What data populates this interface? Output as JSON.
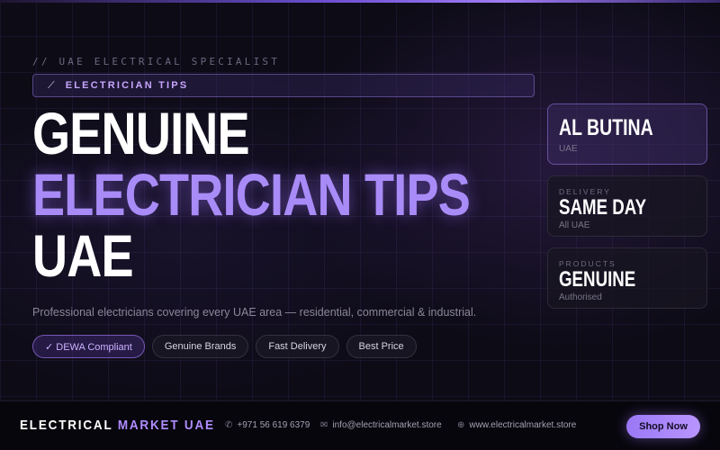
{
  "hero": {
    "eyebrow": "// UAE ELECTRICAL SPECIALIST",
    "tag_icon": "wrench-icon",
    "tag_label": "ELECTRICIAN TIPS",
    "headline_line1": "GENUINE",
    "headline_line2": "ELECTRICIAN TIPS",
    "headline_line3": "UAE",
    "subtitle": "Professional electricians covering every UAE area — residential, commercial & industrial.",
    "pills": [
      {
        "label": "✓ DEWA Compliant"
      },
      {
        "label": "Genuine Brands"
      },
      {
        "label": "Fast Delivery"
      },
      {
        "label": "Best Price"
      }
    ]
  },
  "cards": [
    {
      "label": "",
      "value": "AL BUTINA",
      "sub": "UAE"
    },
    {
      "label": "DELIVERY",
      "value": "SAME DAY",
      "sub": "All UAE"
    },
    {
      "label": "PRODUCTS",
      "value": "GENUINE",
      "sub": "Authorised"
    }
  ],
  "footer": {
    "brand_main": "ELECTRICAL",
    "brand_accent": "MARKET UAE",
    "phone": "+971 56 619 6379",
    "email": "info@electricalmarket.store",
    "website": "www.electricalmarket.store",
    "shop_button": "Shop Now"
  },
  "colors": {
    "accent": "#a98bf8",
    "background": "#0d0b16",
    "footer_bg": "#07060c"
  }
}
